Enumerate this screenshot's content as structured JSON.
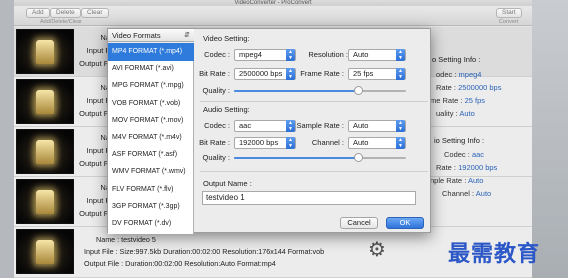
{
  "window": {
    "title": "VideoConverter - ProConvert"
  },
  "toolbar": {
    "add_label": "Add",
    "delete_label": "Delete",
    "clear_label": "Clear",
    "group_caption": "Add/Delete/Clear",
    "start_label": "Start",
    "start_caption": "Convert"
  },
  "rows": [
    {
      "name_label": "Na",
      "input_label": "Input F",
      "output_label": "Output Fi"
    },
    {
      "name_label": "Na",
      "input_label": "Input F",
      "output_label": "Output Fi"
    },
    {
      "name_label": "Na",
      "input_label": "Input F",
      "output_label": "Output Fi"
    },
    {
      "name_label": "Na",
      "input_label": "Input F",
      "output_label": "Output Fi"
    },
    {
      "name_line": "Name : testvideo 5",
      "input_line": "Input File : Size:997.5kb  Duration:00:02:00  Resolution:176x144  Format:vob",
      "output_line": "Output File : Duration:00:02:00  Resolution:Auto  Format:mp4"
    }
  ],
  "right_info": {
    "video_heading": "o Setting Info :",
    "video_codec_key": "odec :",
    "video_codec_val": "mpeg4",
    "video_bitrate_key": "Rate :",
    "video_bitrate_val": "2500000 bps",
    "video_framerate_key": "me Rate :",
    "video_framerate_val": "25 fps",
    "video_quality_key": "uality :",
    "video_quality_val": "Auto",
    "audio_heading": "io Setting Info :",
    "audio_codec_key": "Codec :",
    "audio_codec_val": "aac",
    "audio_bitrate_key": "Rate :",
    "audio_bitrate_val": "192000 bps",
    "audio_samplerate_key": "nple Rate :",
    "audio_samplerate_val": "Auto",
    "audio_channel_key": "Channel :",
    "audio_channel_val": "Auto"
  },
  "dialog": {
    "format_header": "Video Formats",
    "formats": [
      "MP4 FORMAT (*.mp4)",
      "AVI FORMAT (*.avi)",
      "MPG FORMAT (*.mpg)",
      "VOB FORMAT (*.vob)",
      "MOV FORMAT (*.mov)",
      "M4V FORMAT (*.m4v)",
      "ASF FORMAT (*.asf)",
      "WMV FORMAT (*.wmv)",
      "FLV FORMAT (*.flv)",
      "3GP FORMAT (*.3gp)",
      "DV FORMAT (*.dv)"
    ],
    "selected_format_index": 0,
    "video_section": "Video Setting:",
    "codec_label": "Codec :",
    "video_codec": "mpeg4",
    "resolution_label": "Resolution :",
    "resolution": "Auto",
    "bitrate_label": "Bit Rate :",
    "video_bitrate": "2500000 bps",
    "framerate_label": "Frame Rate :",
    "framerate": "25 fps",
    "quality_label": "Quality :",
    "video_quality_level": 0.72,
    "audio_section": "Audio Setting:",
    "audio_codec": "aac",
    "samplerate_label": "Sample Rate :",
    "samplerate": "Auto",
    "audio_bitrate": "192000 bps",
    "channel_label": "Channel :",
    "channel": "Auto",
    "audio_quality_level": 0.72,
    "output_name_label": "Output Name :",
    "output_name": "testvideo 1",
    "cancel_label": "Cancel",
    "ok_label": "OK"
  },
  "watermark": "最需教育",
  "colors": {
    "accent": "#2f7bdb",
    "value_blue": "#2a63b8",
    "watermark": "#2b57c7"
  }
}
